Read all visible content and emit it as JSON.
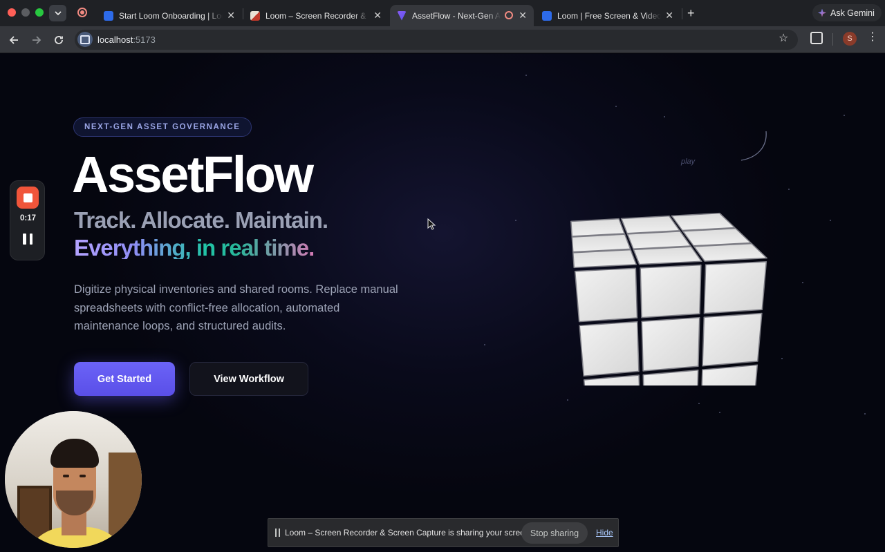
{
  "browser": {
    "tabs": [
      {
        "title": "Start Loom Onboarding | Loom",
        "favicon_color": "#2d6bea",
        "active": false
      },
      {
        "title": "Loom – Screen Recorder & Screen Capture",
        "favicon_color": "#e8e1d5",
        "active": false
      },
      {
        "title": "AssetFlow - Next-Gen Asset Governance",
        "favicon_color": "#8a5cf6",
        "active": true
      },
      {
        "title": "Loom | Free Screen & Video Recording",
        "favicon_color": "#2d6bea",
        "active": false
      }
    ],
    "new_tab": "+",
    "ask_gemini": "Ask Gemini",
    "url_host": "localhost",
    "url_port": ":5173",
    "profile_initial": "S"
  },
  "hero": {
    "eyebrow": "NEXT-GEN ASSET GOVERNANCE",
    "title": "AssetFlow",
    "tagline": "Track. Allocate. Maintain.",
    "tagline_highlight": "Everything, in real time.",
    "description": "Digitize physical inventories and shared rooms. Replace manual spreadsheets with conflict-free allocation, automated maintenance loops, and structured audits.",
    "primary_cta": "Get Started",
    "secondary_cta": "View Workflow",
    "cube_hint": "play"
  },
  "recorder": {
    "elapsed": "0:17"
  },
  "share_bar": {
    "message": "Loom – Screen Recorder & Screen Capture is sharing your screen.",
    "stop_label": "Stop sharing",
    "hide_label": "Hide"
  },
  "colors": {
    "accent": "#5b52ee",
    "recorder_red": "#f0553a",
    "teal": "#21c4a6"
  }
}
